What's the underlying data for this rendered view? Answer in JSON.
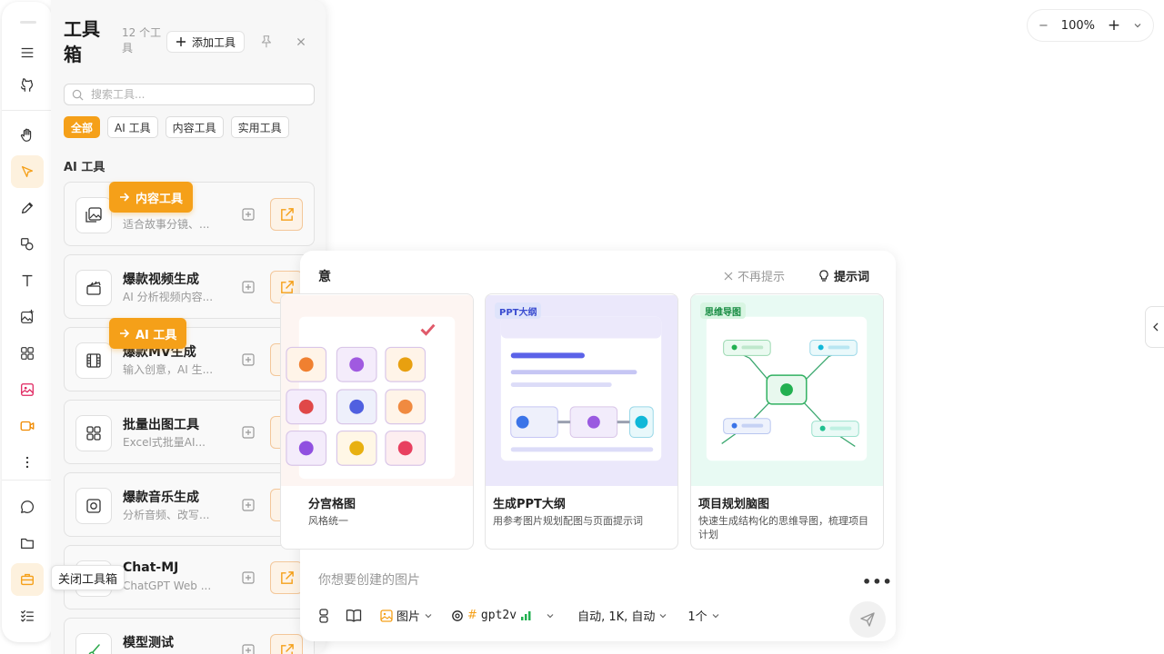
{
  "toolbox": {
    "title": "工具箱",
    "count": "12 个工具",
    "add_label": "添加工具",
    "search_placeholder": "搜索工具...",
    "filters": [
      "全部",
      "AI 工具",
      "内容工具",
      "实用工具"
    ],
    "active_filter": "全部",
    "section_title": "AI 工具",
    "tools": [
      {
        "name": "",
        "desc": "适合故事分镜、...",
        "icon": "image-edit-icon"
      },
      {
        "name": "爆款视频生成",
        "desc": "AI 分析视频内容...",
        "icon": "clapperboard-icon"
      },
      {
        "name": "爆款MV生成",
        "desc": "输入创意，AI 生...",
        "icon": "film-icon"
      },
      {
        "name": "批量出图工具",
        "desc": "Excel式批量AI...",
        "icon": "grid-icon"
      },
      {
        "name": "爆款音乐生成",
        "desc": "分析音频、改写...",
        "icon": "music-box-icon"
      },
      {
        "name": "Chat-MJ",
        "desc": "ChatGPT Web ...",
        "icon": "chat-icon"
      },
      {
        "name": "模型测试",
        "desc": "",
        "icon": "brush-icon"
      }
    ],
    "drag_badges": [
      "内容工具",
      "AI 工具"
    ],
    "tooltip": "关闭工具箱"
  },
  "zoom": {
    "minus": "−",
    "value": "100%",
    "plus": "+"
  },
  "main": {
    "title": "意",
    "dismiss": "不再提示",
    "hint": "提示词",
    "templates": [
      {
        "tag": "",
        "title": "分宫格图",
        "desc": "风格统一"
      },
      {
        "tag": "PPT大纲",
        "title": "生成PPT大纲",
        "desc": "用参考图片规划配图与页面提示词"
      },
      {
        "tag": "思维导图",
        "title": "项目规划脑图",
        "desc": "快速生成结构化的思维导图，梳理项目计划"
      }
    ],
    "input_placeholder": "你想要创建的图片",
    "more": "•••",
    "type_label": "图片",
    "model_label": "gpt2v",
    "params_label": "自动, 1K, 自动",
    "count_label": "1个"
  },
  "colors": {
    "accent": "#f5a019",
    "accent_light": "#fdf3e7"
  }
}
